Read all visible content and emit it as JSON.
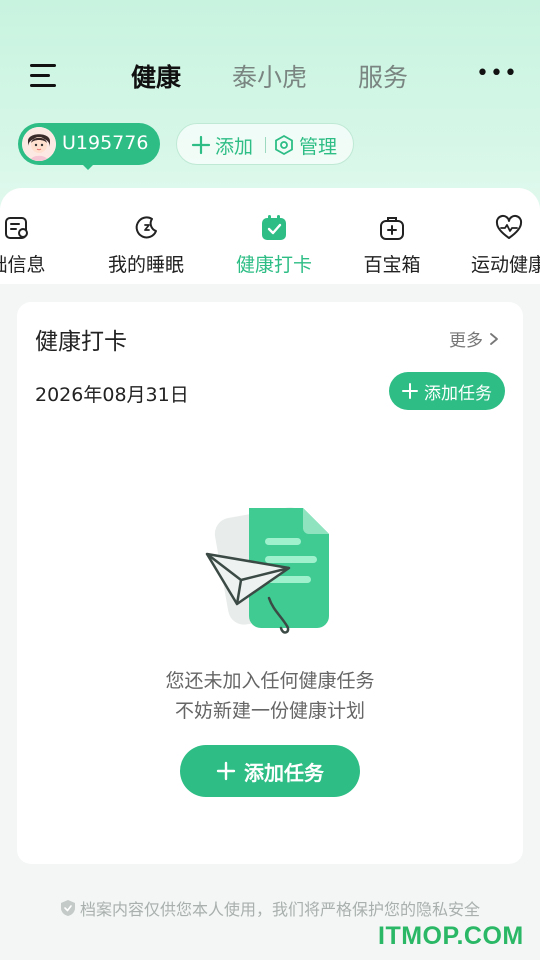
{
  "header": {
    "tabs": [
      {
        "label": "健康",
        "active": true
      },
      {
        "label": "泰小虎",
        "active": false
      },
      {
        "label": "服务",
        "active": false
      }
    ],
    "more_icon": "ellipsis-icon"
  },
  "user": {
    "name": "U195776",
    "add_label": "添加",
    "manage_label": "管理"
  },
  "categories": [
    {
      "label": "础信息",
      "icon": "profile-card-icon"
    },
    {
      "label": "我的睡眠",
      "icon": "moon-icon"
    },
    {
      "label": "健康打卡",
      "icon": "checkin-icon",
      "active": true
    },
    {
      "label": "百宝箱",
      "icon": "medkit-icon"
    },
    {
      "label": "运动健康",
      "icon": "heartbeat-icon"
    }
  ],
  "checkin": {
    "title": "健康打卡",
    "more_label": "更多",
    "date": "2026年08月31日",
    "add_task_label": "添加任务",
    "empty_line1": "您还未加入任何健康任务",
    "empty_line2": "不妨新建一份健康计划",
    "add_task_button": "添加任务"
  },
  "footer": {
    "privacy": "档案内容仅供您本人使用，我们将严格保护您的隐私安全",
    "watermark": "ITMOP.COM"
  },
  "colors": {
    "accent": "#2dbd85",
    "top_gradient": "#c8f3df"
  }
}
